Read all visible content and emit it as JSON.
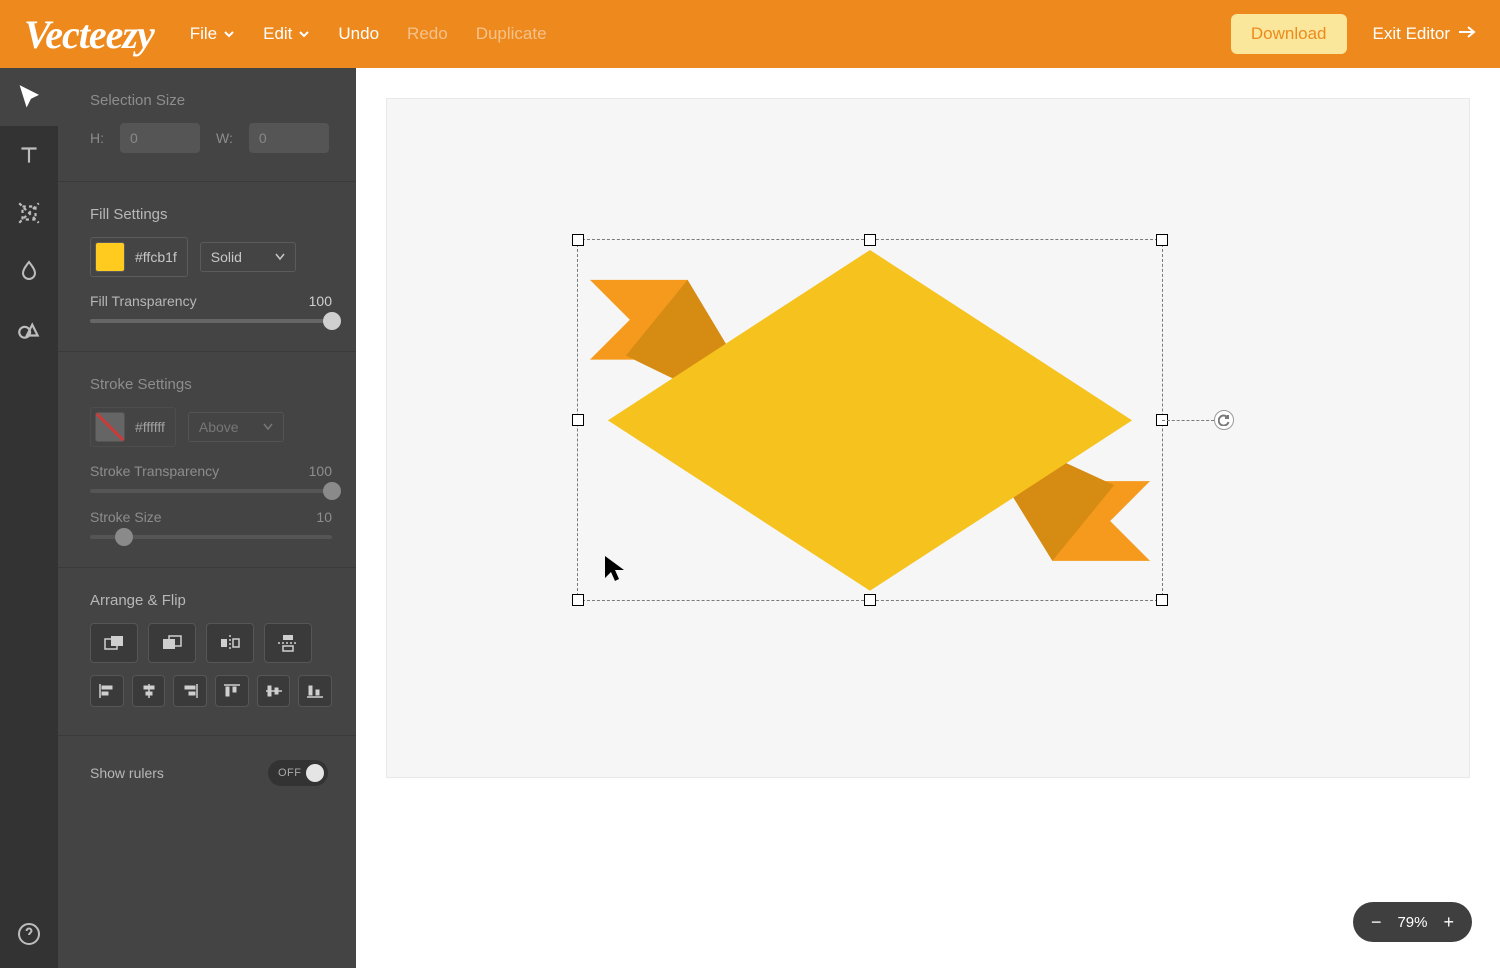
{
  "brand": "Vecteezy",
  "menu": {
    "file": "File",
    "edit": "Edit",
    "undo": "Undo",
    "redo": "Redo",
    "duplicate": "Duplicate"
  },
  "actions": {
    "download": "Download",
    "exit": "Exit Editor"
  },
  "tools": {
    "select": "select-tool",
    "text": "text-tool",
    "crop": "crop-tool",
    "tint": "tint-tool",
    "shapes": "shapes-tool"
  },
  "panel": {
    "selectionSize": {
      "title": "Selection Size",
      "h_label": "H:",
      "w_label": "W:",
      "h": "0",
      "w": "0"
    },
    "fill": {
      "title": "Fill Settings",
      "color": "#ffcb1f",
      "mode": "Solid",
      "transparency_label": "Fill Transparency",
      "transparency": "100"
    },
    "stroke": {
      "title": "Stroke Settings",
      "color": "#ffffff",
      "position": "Above",
      "transparency_label": "Stroke Transparency",
      "transparency": "100",
      "size_label": "Stroke Size",
      "size": "10"
    },
    "arrange": {
      "title": "Arrange & Flip"
    },
    "rulers": {
      "label": "Show rulers",
      "state": "OFF"
    }
  },
  "zoom": {
    "level": "79%",
    "minus": "−",
    "plus": "+"
  },
  "colors": {
    "brand": "#ee8a1d",
    "downloadBg": "#fae79b",
    "canvasShapeMain": "#f5c21e",
    "canvasShapeShade": "#d68b12",
    "canvasShapeRibbon": "#f59a1d"
  }
}
